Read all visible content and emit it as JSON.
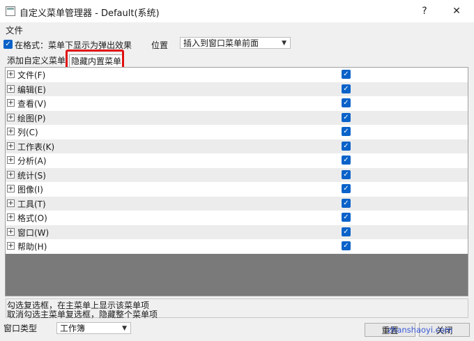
{
  "window": {
    "title": "自定义菜单管理器 - Default(系统)",
    "help_glyph": "?",
    "close_glyph": "✕"
  },
  "menubar": {
    "file": "文件"
  },
  "options": {
    "format_checkbox_label": "在格式：菜单下显示为弹出效果",
    "format_checked": true,
    "position_label": "位置",
    "position_value": "插入到窗口菜单前面"
  },
  "tabs": [
    {
      "label": "添加自定义菜单",
      "active": false
    },
    {
      "label": "隐藏内置菜单",
      "active": true
    }
  ],
  "menu_items": [
    {
      "label": "文件(F)",
      "checked": true
    },
    {
      "label": "编辑(E)",
      "checked": true
    },
    {
      "label": "查看(V)",
      "checked": true
    },
    {
      "label": "绘图(P)",
      "checked": true
    },
    {
      "label": "列(C)",
      "checked": true
    },
    {
      "label": "工作表(K)",
      "checked": true
    },
    {
      "label": "分析(A)",
      "checked": true
    },
    {
      "label": "统计(S)",
      "checked": true
    },
    {
      "label": "图像(I)",
      "checked": true
    },
    {
      "label": "工具(T)",
      "checked": true
    },
    {
      "label": "格式(O)",
      "checked": true
    },
    {
      "label": "窗口(W)",
      "checked": true
    },
    {
      "label": "帮助(H)",
      "checked": true
    }
  ],
  "status": {
    "line1": "勾选复选框，在主菜单上显示该菜单项",
    "line2": "取消勾选主菜单复选框，隐藏整个菜单项"
  },
  "footer": {
    "window_type_label": "窗口类型",
    "window_type_value": "工作簿",
    "reset_label": "重置",
    "ok_label": "关闭"
  },
  "watermark": "zhanshaoyi.com",
  "colors": {
    "accent": "#0a62c9",
    "highlight": "#e01010"
  }
}
